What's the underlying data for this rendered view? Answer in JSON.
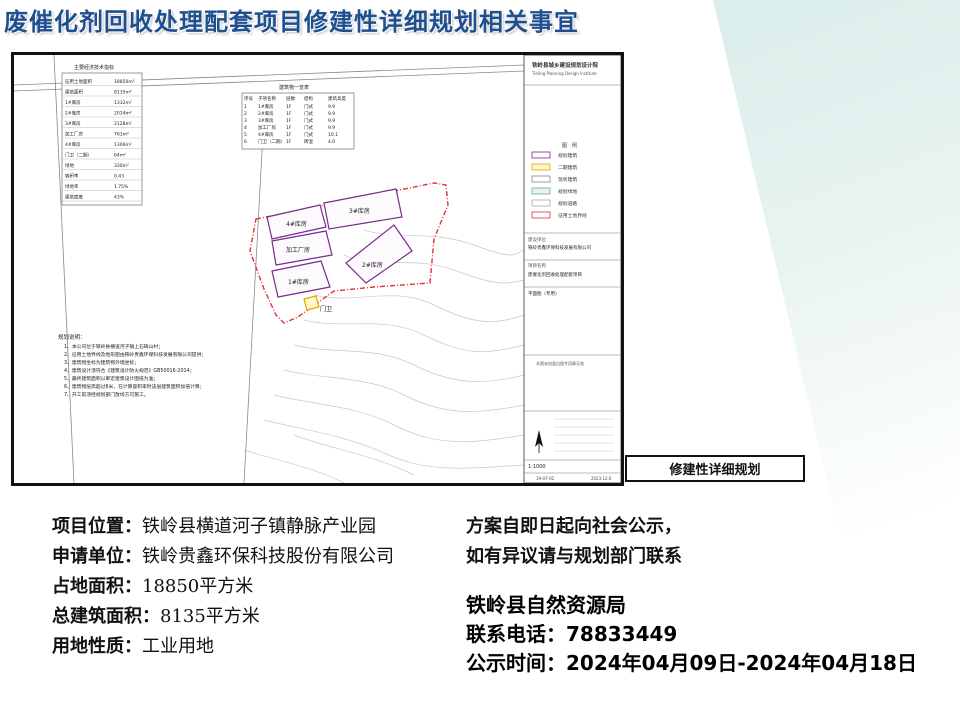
{
  "page": {
    "title": "废催化剂回收处理配套项目修建性详细规划相关事宜",
    "plan_label": "修建性详细规划"
  },
  "plan": {
    "table_left_title": "主要经济技术指标",
    "table_left_rows": [
      [
        "征用土地面积",
        "18850m²"
      ],
      [
        "建筑面积",
        "8135m²"
      ],
      [
        "1#库房",
        "1332m²"
      ],
      [
        "2#库房",
        "2014m²"
      ],
      [
        "3#库房",
        "2128m²"
      ],
      [
        "加工厂房",
        "761m²"
      ],
      [
        "4#库房",
        "1306m²"
      ],
      [
        "门卫（二期）",
        "64m²"
      ],
      [
        "绿地",
        "330m²"
      ],
      [
        "容积率",
        "0.43"
      ],
      [
        "绿地率",
        "1.75%"
      ],
      [
        "建筑密度",
        "43%"
      ]
    ],
    "table_right_title": "建筑物一览表",
    "table_right_header": [
      "序号",
      "子项名称",
      "层数",
      "结构",
      "建筑高度"
    ],
    "table_right_rows": [
      [
        "1",
        "1#库房",
        "1F",
        "门式",
        "9.9"
      ],
      [
        "2",
        "2#库房",
        "1F",
        "门式",
        "9.9"
      ],
      [
        "3",
        "3#库房",
        "1F",
        "门式",
        "9.9"
      ],
      [
        "4",
        "加工厂房",
        "1F",
        "门式",
        "9.9"
      ],
      [
        "5",
        "4#库房",
        "1F",
        "门式",
        "10.1"
      ],
      [
        "6",
        "门卫（二期）",
        "1F",
        "砖混",
        "4.0"
      ]
    ],
    "buildings": [
      "4#库房",
      "3#库房",
      "加工厂房",
      "1#库房",
      "2#库房",
      "门卫"
    ],
    "notes_title": "规划说明：",
    "notes": [
      "1、本公司位于铁岭县横道河子镇上石碑山村；",
      "2、征用土地界线及地形图由铁岭贵鑫环保科技发展有限公司提供；",
      "3、建筑物坐标为建筑物外墙坐标；",
      "4、建筑设计须符合《建筑设计防火规范》GB50016-2014；",
      "5、最终建筑面积以审定建筑设计图纸为准；",
      "6、建筑物层高超过8米，在计算容积率时该层建筑面积加倍计算；",
      "7、开工前须经规划部门放线方可施工。"
    ],
    "institute_name": "铁岭县城乡建设规划设计院",
    "institute_en": "Tieling Planning Design Institute",
    "legend_title": "图　例",
    "legend_items": [
      "规划建筑",
      "二期建筑",
      "现状建筑",
      "规划绿地",
      "规划道路",
      "征用土地界线"
    ],
    "client_label": "建设单位",
    "client": "铁岭贵鑫环保科技发展有限公司",
    "project_label": "项目名称",
    "project": "废催化剂回收处理配套项目",
    "drawing_label": "平面图（专用）",
    "stamp_text": "本图未加盖出图专用章无效",
    "scale": "1:1000",
    "date_code": "19-07-02",
    "year_code": "2023.12.6"
  },
  "info": {
    "location_label": "项目位置：",
    "location": "铁岭县横道河子镇静脉产业园",
    "applicant_label": "申请单位：",
    "applicant": "铁岭贵鑫环保科技股份有限公司",
    "area_label": "占地面积：",
    "area": "18850平方米",
    "building_area_label": "总建筑面积：",
    "building_area": "8135平方米",
    "land_use_label": "用地性质：",
    "land_use": "工业用地"
  },
  "notice": {
    "line1": "方案自即日起向社会公示，",
    "line2": "如有异议请与规划部门联系"
  },
  "bureau": {
    "name": "铁岭县自然资源局",
    "phone": "联系电话：78833449",
    "period": "公示时间：2024年04月09日-2024年04月18日"
  },
  "colors": {
    "title": "#1f4f8f",
    "boundary": "#e0313a",
    "planned_building": "#7a2a8a",
    "accent_bg": "#d7ece9"
  }
}
